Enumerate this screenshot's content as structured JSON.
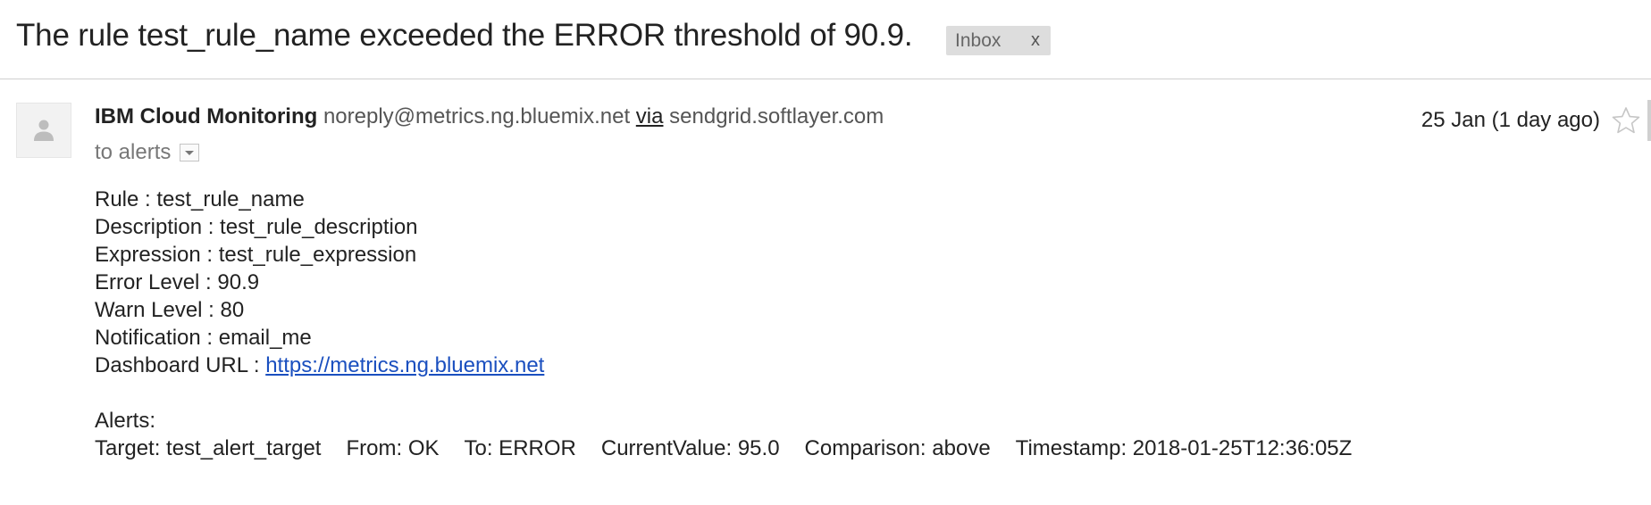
{
  "email": {
    "subject": "The rule test_rule_name exceeded the ERROR threshold of 90.9.",
    "label": {
      "name": "Inbox",
      "remove": "x"
    },
    "sender": {
      "name": "IBM Cloud Monitoring",
      "email": "noreply@metrics.ng.bluemix.net",
      "via_label": "via",
      "via_domain": "sendgrid.softlayer.com"
    },
    "recipient": "to alerts",
    "date": "25 Jan (1 day ago)",
    "icons": {
      "avatar": "person-icon",
      "star": "star-icon",
      "recipient_dropdown": "chevron-down-icon"
    },
    "body": {
      "rule": "Rule : test_rule_name",
      "description": "Description : test_rule_description",
      "expression": "Expression : test_rule_expression",
      "error_level": "Error Level : 90.9",
      "warn_level": "Warn Level : 80",
      "notification": "Notification : email_me",
      "dashboard_label": "Dashboard URL : ",
      "dashboard_url": "https://metrics.ng.bluemix.net",
      "alerts_heading": "Alerts:",
      "alert": {
        "target": "Target: test_alert_target",
        "from": "From: OK",
        "to": "To: ERROR",
        "current_value": "CurrentValue: 95.0",
        "comparison": "Comparison: above",
        "timestamp": "Timestamp: 2018-01-25T12:36:05Z"
      }
    }
  },
  "colors": {
    "link": "#1a4fbf",
    "chip_background": "#dddddd",
    "divider": "#cfcfcf"
  }
}
